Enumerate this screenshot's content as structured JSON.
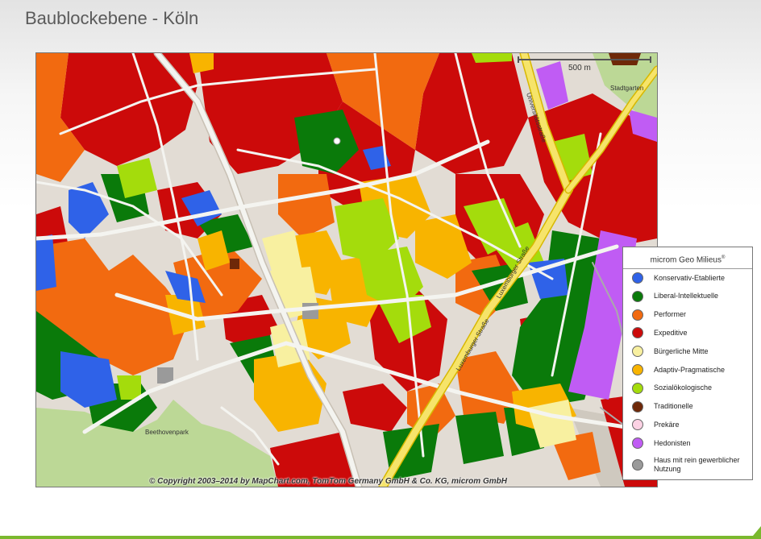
{
  "page": {
    "title": "Baublockebene - Köln"
  },
  "map": {
    "scale_label": "500 m",
    "copyright": "© Copyright 2003–2014 by MapChart.com, TomTom Germany GmbH & Co. KG, microm GmbH",
    "street_labels": [
      {
        "text": "Universitätsstraße"
      },
      {
        "text": "Luxemburger Straße"
      },
      {
        "text": "Luxemburger Straße"
      },
      {
        "text": "Stadtgarten"
      },
      {
        "text": "Beethovenpark"
      }
    ]
  },
  "legend": {
    "title": "microm Geo Milieus",
    "title_mark": "®",
    "items": [
      {
        "label": "Konservativ-Etablierte",
        "color": "#2f62e8"
      },
      {
        "label": "Liberal-Intellektuelle",
        "color": "#0a7a0a"
      },
      {
        "label": "Performer",
        "color": "#f26a10"
      },
      {
        "label": "Expeditive",
        "color": "#cc0a0a"
      },
      {
        "label": "Bürgerliche Mitte",
        "color": "#f8f0a0"
      },
      {
        "label": "Adaptiv-Pragmatische",
        "color": "#f8b400"
      },
      {
        "label": "Sozialökologische",
        "color": "#a4dc0c"
      },
      {
        "label": "Traditionelle",
        "color": "#6e2808"
      },
      {
        "label": "Prekäre",
        "color": "#fcd2e4"
      },
      {
        "label": "Hedonisten",
        "color": "#c05cf4"
      },
      {
        "label": "Haus mit rein gewerblicher Nutzung",
        "color": "#9a9a9a"
      }
    ]
  },
  "colors": {
    "road": "#f4f4f0",
    "road_border": "#c8c0b4",
    "highway": "#f6e46a",
    "park": "#bcd896",
    "background": "#e2dcd4",
    "accent_bar": "#7ab82e"
  }
}
